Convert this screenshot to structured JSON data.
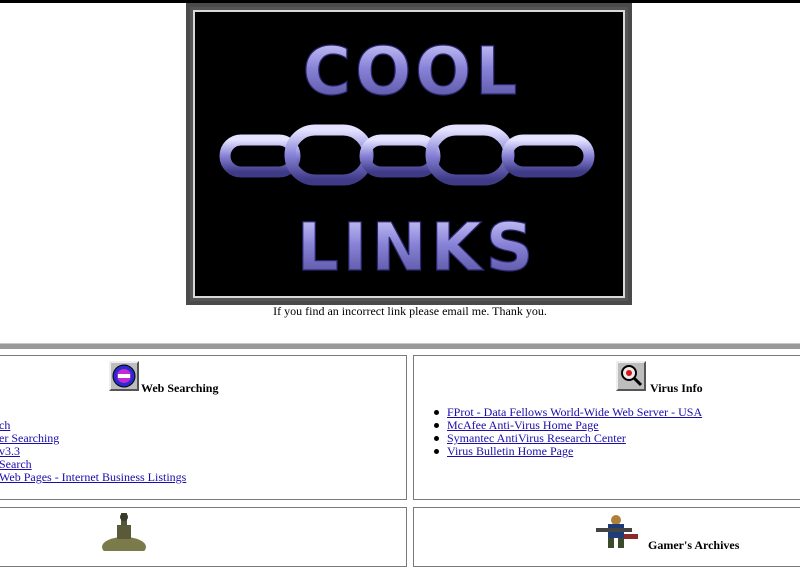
{
  "banner": {
    "top_word": "COOL",
    "bottom_word": "LINKS",
    "caption": "If you find an incorrect link please email me. Thank you."
  },
  "panels": {
    "web_searching": {
      "title": "Web Searching",
      "icon": "globe-icon",
      "links": [
        "ch",
        "er Searching",
        " v3.3",
        " Search",
        "Web Pages - Internet Business Listings"
      ]
    },
    "virus_info": {
      "title": "Virus Info",
      "icon": "magnifier-icon",
      "links": [
        "FProt - Data Fellows World-Wide Web Server - USA",
        "McAfee Anti-Virus Home Page",
        "Symantec AntiVirus Research Center",
        "Virus Bulletin Home Page"
      ]
    },
    "gamers_archives": {
      "title": "Gamer's Archives",
      "icon": "soldier-icon"
    },
    "bottom_left": {
      "icon": "statue-icon"
    }
  },
  "colors": {
    "link": "#1a0dab",
    "banner_bg": "#000000",
    "letters": "#8f8ad8",
    "rule": "#9a9a9a"
  }
}
